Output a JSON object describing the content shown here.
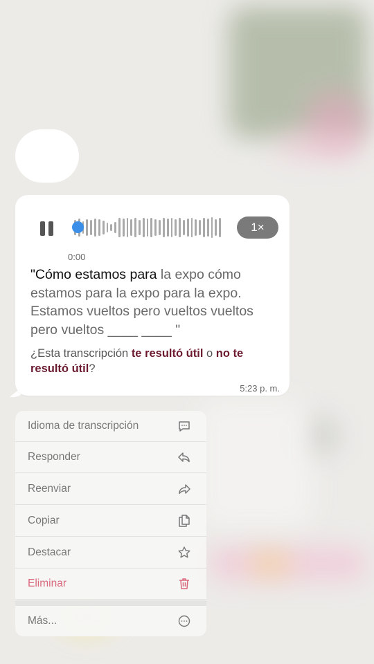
{
  "audio_message": {
    "elapsed_time": "0:00",
    "playback_speed": "1×",
    "transcript_played": "\"Cómo estamos para",
    "transcript_rest": " la expo cómo estamos para la expo para la expo. Estamos vueltos pero vueltos vueltos pero vueltos ____ ____ \"",
    "feedback_prefix": "¿Esta transcripción ",
    "feedback_useful": "te resultó útil",
    "feedback_or": " o ",
    "feedback_not_useful": "no te resultó útil",
    "feedback_suffix": "?",
    "timestamp": "5:23 p. m.",
    "accent_color": "#3b8fe8"
  },
  "context_menu": {
    "items": [
      {
        "label": "Idioma de transcripción",
        "icon": "speech-bubble-icon"
      },
      {
        "label": "Responder",
        "icon": "reply-arrow-icon"
      },
      {
        "label": "Reenviar",
        "icon": "forward-arrow-icon"
      },
      {
        "label": "Copiar",
        "icon": "copy-icon"
      },
      {
        "label": "Destacar",
        "icon": "star-icon"
      },
      {
        "label": "Eliminar",
        "icon": "trash-icon",
        "color": "#d9687d"
      },
      {
        "label": "Más...",
        "icon": "more-icon"
      }
    ]
  }
}
